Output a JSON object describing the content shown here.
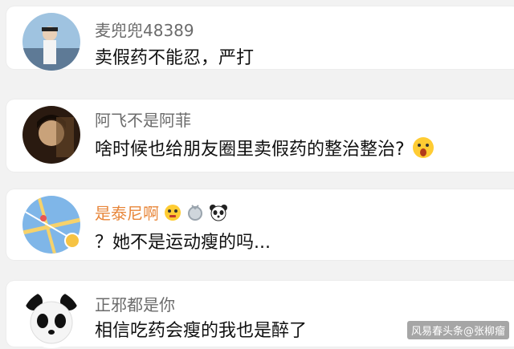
{
  "comments": [
    {
      "username": "麦兜兜48389",
      "text": "卖假药不能忍，严打",
      "avatar_icon": "woman-photo-avatar"
    },
    {
      "username": "阿飞不是阿菲",
      "text": "啥时候也给朋友圈里卖假药的整治整治?",
      "avatar_icon": "man-photo-avatar",
      "trailing_emoji": "surprised-face-icon"
    },
    {
      "username": "是泰尼啊",
      "text": "？她不是运动瘦的吗...",
      "avatar_icon": "map-avatar",
      "name_color": "#e8863a",
      "badges": [
        "crying-face-icon",
        "silver-medal-icon",
        "panda-face-icon"
      ],
      "verified_badge": "gold-v-badge-icon"
    },
    {
      "username": "正邪都是你",
      "text": "相信吃药会瘦的我也是醉了",
      "avatar_icon": "panda-avatar"
    }
  ],
  "watermark": "风易春头条@张柳瘤"
}
